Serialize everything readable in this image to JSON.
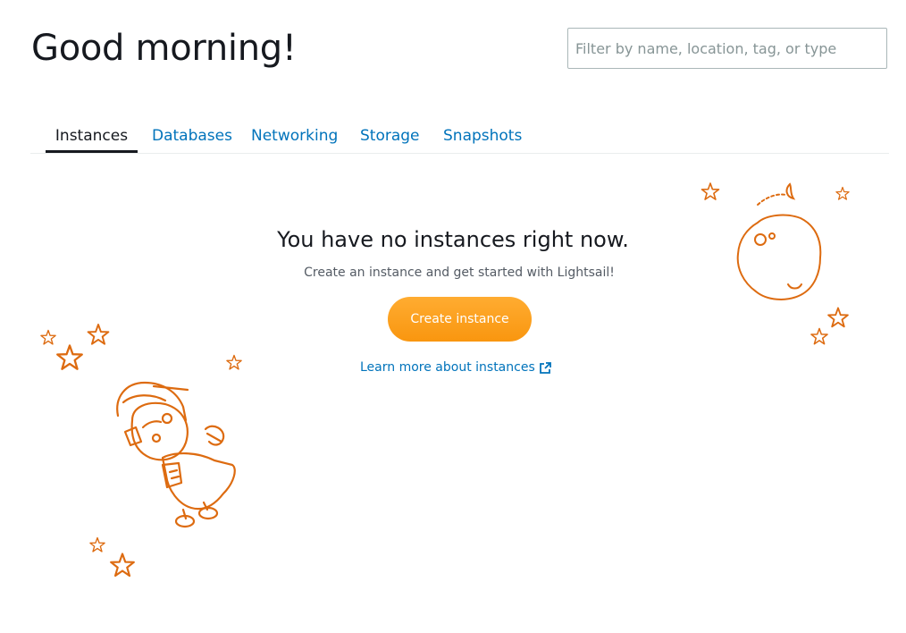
{
  "header": {
    "greeting": "Good morning!"
  },
  "search": {
    "placeholder": "Filter by name, location, tag, or type",
    "value": ""
  },
  "tabs": [
    {
      "label": "Instances",
      "active": true
    },
    {
      "label": "Databases",
      "active": false
    },
    {
      "label": "Networking",
      "active": false
    },
    {
      "label": "Storage",
      "active": false
    },
    {
      "label": "Snapshots",
      "active": false
    }
  ],
  "empty_state": {
    "title": "You have no instances right now.",
    "subtitle": "Create an instance and get started with Lightsail!",
    "create_button": "Create instance",
    "learn_more_link": "Learn more about instances"
  },
  "icons": {
    "learn_more": "external-link-icon",
    "robot": "robot-illustration",
    "moon": "moon-illustration",
    "stars": "star-icon"
  },
  "colors": {
    "accent_orange": "#f7981d",
    "illustration_orange": "#dd6b10",
    "link_blue": "#0073bb",
    "text_dark": "#16191f",
    "text_muted": "#545b64"
  }
}
